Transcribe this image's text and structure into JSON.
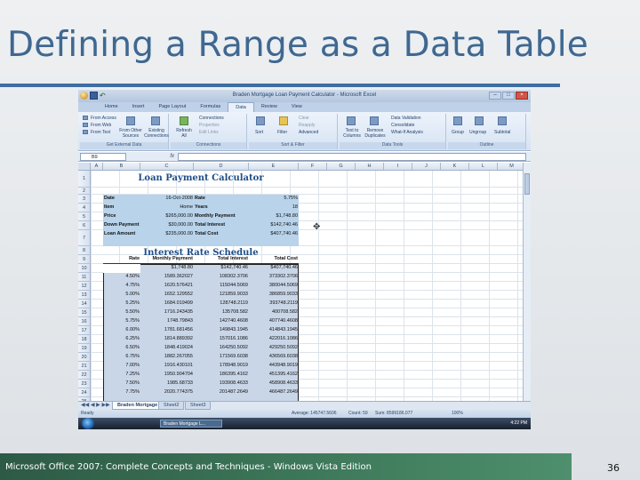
{
  "slide": {
    "title": "Defining a Range as a Data Table",
    "footer": "Microsoft Office 2007: Complete Concepts and Techniques - Windows Vista Edition",
    "page_number": "36"
  },
  "excel": {
    "window_title": "Braden Mortgage Loan Payment Calculator - Microsoft Excel",
    "tabs": [
      "Home",
      "Insert",
      "Page Layout",
      "Formulas",
      "Data",
      "Review",
      "View"
    ],
    "active_tab": "Data",
    "ribbon": {
      "get_external": {
        "items": [
          "From Access",
          "From Web",
          "From Text",
          "From Other Sources",
          "Existing Connections"
        ],
        "label": "Get External Data"
      },
      "connections": {
        "items": [
          "Refresh All",
          "Connections",
          "Properties",
          "Edit Links"
        ],
        "label": "Connections"
      },
      "sort_filter": {
        "items": [
          "Sort",
          "Filter",
          "Clear",
          "Reapply",
          "Advanced"
        ],
        "label": "Sort & Filter"
      },
      "data_tools": {
        "items": [
          "Text to Columns",
          "Remove Duplicates",
          "Data Validation",
          "Consolidate",
          "What-If Analysis"
        ],
        "label": "Data Tools"
      },
      "outline": {
        "items": [
          "Group",
          "Ungroup",
          "Subtotal"
        ],
        "label": "Outline"
      }
    },
    "name_box": "B9",
    "fx": "fx",
    "columns": [
      "A",
      "B",
      "C",
      "D",
      "E",
      "F",
      "G",
      "H",
      "I",
      "J",
      "K",
      "L",
      "M"
    ],
    "rows": [
      "1",
      "2",
      "3",
      "4",
      "5",
      "6",
      "7",
      "8",
      "9",
      "10",
      "11",
      "12",
      "13",
      "14",
      "15",
      "16",
      "17",
      "18",
      "19",
      "20",
      "21",
      "22",
      "23",
      "24",
      "25"
    ],
    "calculator": {
      "title": "Loan Payment Calculator",
      "rows": [
        {
          "l1": "Date",
          "v1": "16-Oct-2008",
          "l2": "Rate",
          "v2": "5.75%"
        },
        {
          "l1": "Item",
          "v1": "Home",
          "l2": "Years",
          "v2": "18"
        },
        {
          "l1": "Price",
          "v1": "$265,000.00",
          "l2": "Monthly Payment",
          "v2": "$1,748.80"
        },
        {
          "l1": "Down Payment",
          "v1": "$30,000.00",
          "l2": "Total Interest",
          "v2": "$142,740.46"
        },
        {
          "l1": "Loan Amount",
          "v1": "$235,000.00",
          "l2": "Total Cost",
          "v2": "$407,740.46"
        }
      ]
    },
    "schedule": {
      "title": "Interest Rate Schedule",
      "headers": [
        "Rate",
        "Monthly Payment",
        "Total Interest",
        "Total Cost"
      ],
      "first": [
        "",
        "$1,748.80",
        "$142,740.46",
        "$407,740.46"
      ],
      "rows": [
        [
          "4.50%",
          "1589.362027",
          "108302.3706",
          "373302.3706"
        ],
        [
          "4.75%",
          "1620.576421",
          "115044.5069",
          "380044.5069"
        ],
        [
          "5.00%",
          "1652.129552",
          "121859.9033",
          "386859.9033"
        ],
        [
          "5.25%",
          "1684.019499",
          "128748.2119",
          "393748.2119"
        ],
        [
          "5.50%",
          "1716.243435",
          "135708.582",
          "400708.582"
        ],
        [
          "5.75%",
          "1748.79843",
          "142740.4608",
          "407740.4608"
        ],
        [
          "6.00%",
          "1781.681456",
          "149843.1945",
          "414843.1945"
        ],
        [
          "6.25%",
          "1814.889392",
          "157016.1086",
          "422016.1086"
        ],
        [
          "6.50%",
          "1848.419024",
          "164250.5092",
          "429250.5092"
        ],
        [
          "6.75%",
          "1882.267055",
          "171569.6038",
          "436569.6038"
        ],
        [
          "7.00%",
          "1916.430101",
          "178948.9019",
          "443948.9019"
        ],
        [
          "7.25%",
          "1950.904704",
          "186395.4162",
          "451395.4162"
        ],
        [
          "7.50%",
          "1985.68733",
          "193908.4633",
          "458908.4633"
        ],
        [
          "7.75%",
          "2020.774375",
          "201487.2649",
          "466487.2649"
        ]
      ]
    },
    "sheet_tabs": [
      "Braden Mortgage",
      "Sheet2",
      "Sheet3"
    ],
    "active_sheet": "Braden Mortgage",
    "status": {
      "ready": "Ready",
      "average": "Average: 145747.5606",
      "count": "Count: 59",
      "sum": "Sum: 8599186.077",
      "zoom": "100%"
    },
    "taskbar": {
      "item": "Braden Mortgage L...",
      "clock": "4:22 PM"
    }
  }
}
